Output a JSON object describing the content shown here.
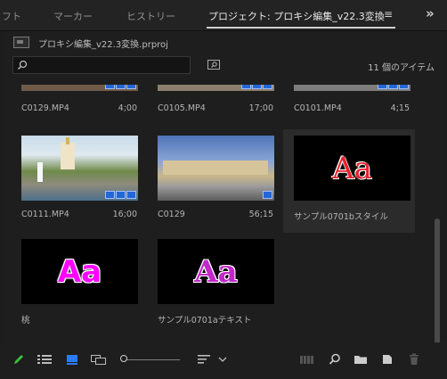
{
  "tabs": [
    {
      "label": "フト",
      "active": false
    },
    {
      "label": "マーカー",
      "active": false
    },
    {
      "label": "ヒストリー",
      "active": false
    },
    {
      "label": "プロジェクト: プロキシ編集_v22.3変換",
      "active": true
    }
  ],
  "project": {
    "file_name": "プロキシ編集_v22.3変換.prproj",
    "item_count": "11 個のアイテム",
    "search_placeholder": ""
  },
  "items": [
    {
      "name": "C0129.MP4",
      "duration": "4;00"
    },
    {
      "name": "C0105.MP4",
      "duration": "17;00"
    },
    {
      "name": "C0101.MP4",
      "duration": "4;15"
    },
    {
      "name": "C0111.MP4",
      "duration": "16;00"
    },
    {
      "name": "C0129",
      "duration": "56;15"
    },
    {
      "name": "サンプル0701bスタイル",
      "duration": "",
      "thumb_text": "Aa"
    },
    {
      "name": "桃",
      "duration": "",
      "thumb_text": "Aa"
    },
    {
      "name": "サンプル0701aテキスト",
      "duration": "",
      "thumb_text": "Aa"
    }
  ],
  "colors": {
    "accent_blue": "#2267d8",
    "edit_green": "#3fbf3f",
    "aa_red": "#e8202a",
    "aa_magenta": "#ff00ff",
    "aa_purple": "#c028c8"
  }
}
